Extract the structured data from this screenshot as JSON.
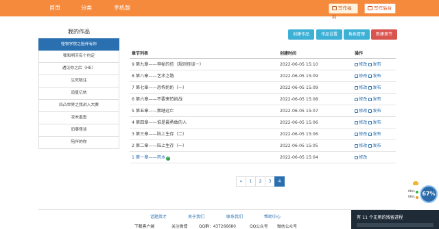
{
  "topbar": {
    "nav": [
      "首页",
      "分类",
      "手机版"
    ],
    "welfare_label": "写作福利",
    "backend_label": "写作后台"
  },
  "sidebar": {
    "title": "我的作品",
    "items": [
      "怪物学院之陪伴有你",
      "我和明天有个约定",
      "遇见你之后（HE）",
      "生死陪注",
      "追星亿侬",
      "凹凸世界之我讲入大赛",
      "凌云墨鱼",
      "旧事怪谈",
      "陪伴的你"
    ]
  },
  "actions": {
    "create_work": "创建作品",
    "work_settings": "作品设置",
    "role_manage": "角色管理",
    "new_chapter": "新建章节"
  },
  "table": {
    "headers": [
      "章节列表",
      "创建时间",
      "操作"
    ],
    "edit_label": "修改",
    "publish_label": "发布",
    "rows": [
      {
        "title": "9 第九章——神秘的信（规则怪谈一）",
        "time": "2022-06-05 15:10",
        "published": false
      },
      {
        "title": "8 第八章——艺术之路",
        "time": "2022-06-05 15:09",
        "published": false
      },
      {
        "title": "7 第七章——恐怖奶奶（一）",
        "time": "2022-06-05 15:09",
        "published": false
      },
      {
        "title": "6 第六章——不要害怕挑战",
        "time": "2022-06-05 15:08",
        "published": false
      },
      {
        "title": "5 第五章——葬踏远亡",
        "time": "2022-06-05 15:07",
        "published": false
      },
      {
        "title": "4 第四章——谁是最勇敢的人",
        "time": "2022-06-05 15:06",
        "published": false
      },
      {
        "title": "3 第三章——陆上生存（二）",
        "time": "2022-06-05 15:06",
        "published": false
      },
      {
        "title": "2 第二章——陆上生存（一）",
        "time": "2022-06-05 15:05",
        "published": false
      },
      {
        "title": "1 第一章——药水",
        "time": "2022-06-05 15:04",
        "published": true
      }
    ]
  },
  "pagination": {
    "prev": "«",
    "pages": [
      "1",
      "2",
      "3",
      "4"
    ],
    "active_page": "4"
  },
  "footer": {
    "links": [
      "话题英才",
      "关于我们",
      "联系我们",
      "帮助中心"
    ],
    "info": [
      "下载客户端",
      "关注微博",
      "QQ群：437266680",
      "QQ公众号",
      "微信公众号"
    ]
  },
  "floating": {
    "message": "有 11 个无用的残留进程",
    "percent": "67%",
    "speed_up": "0K/s",
    "speed_down": "0K/s"
  }
}
